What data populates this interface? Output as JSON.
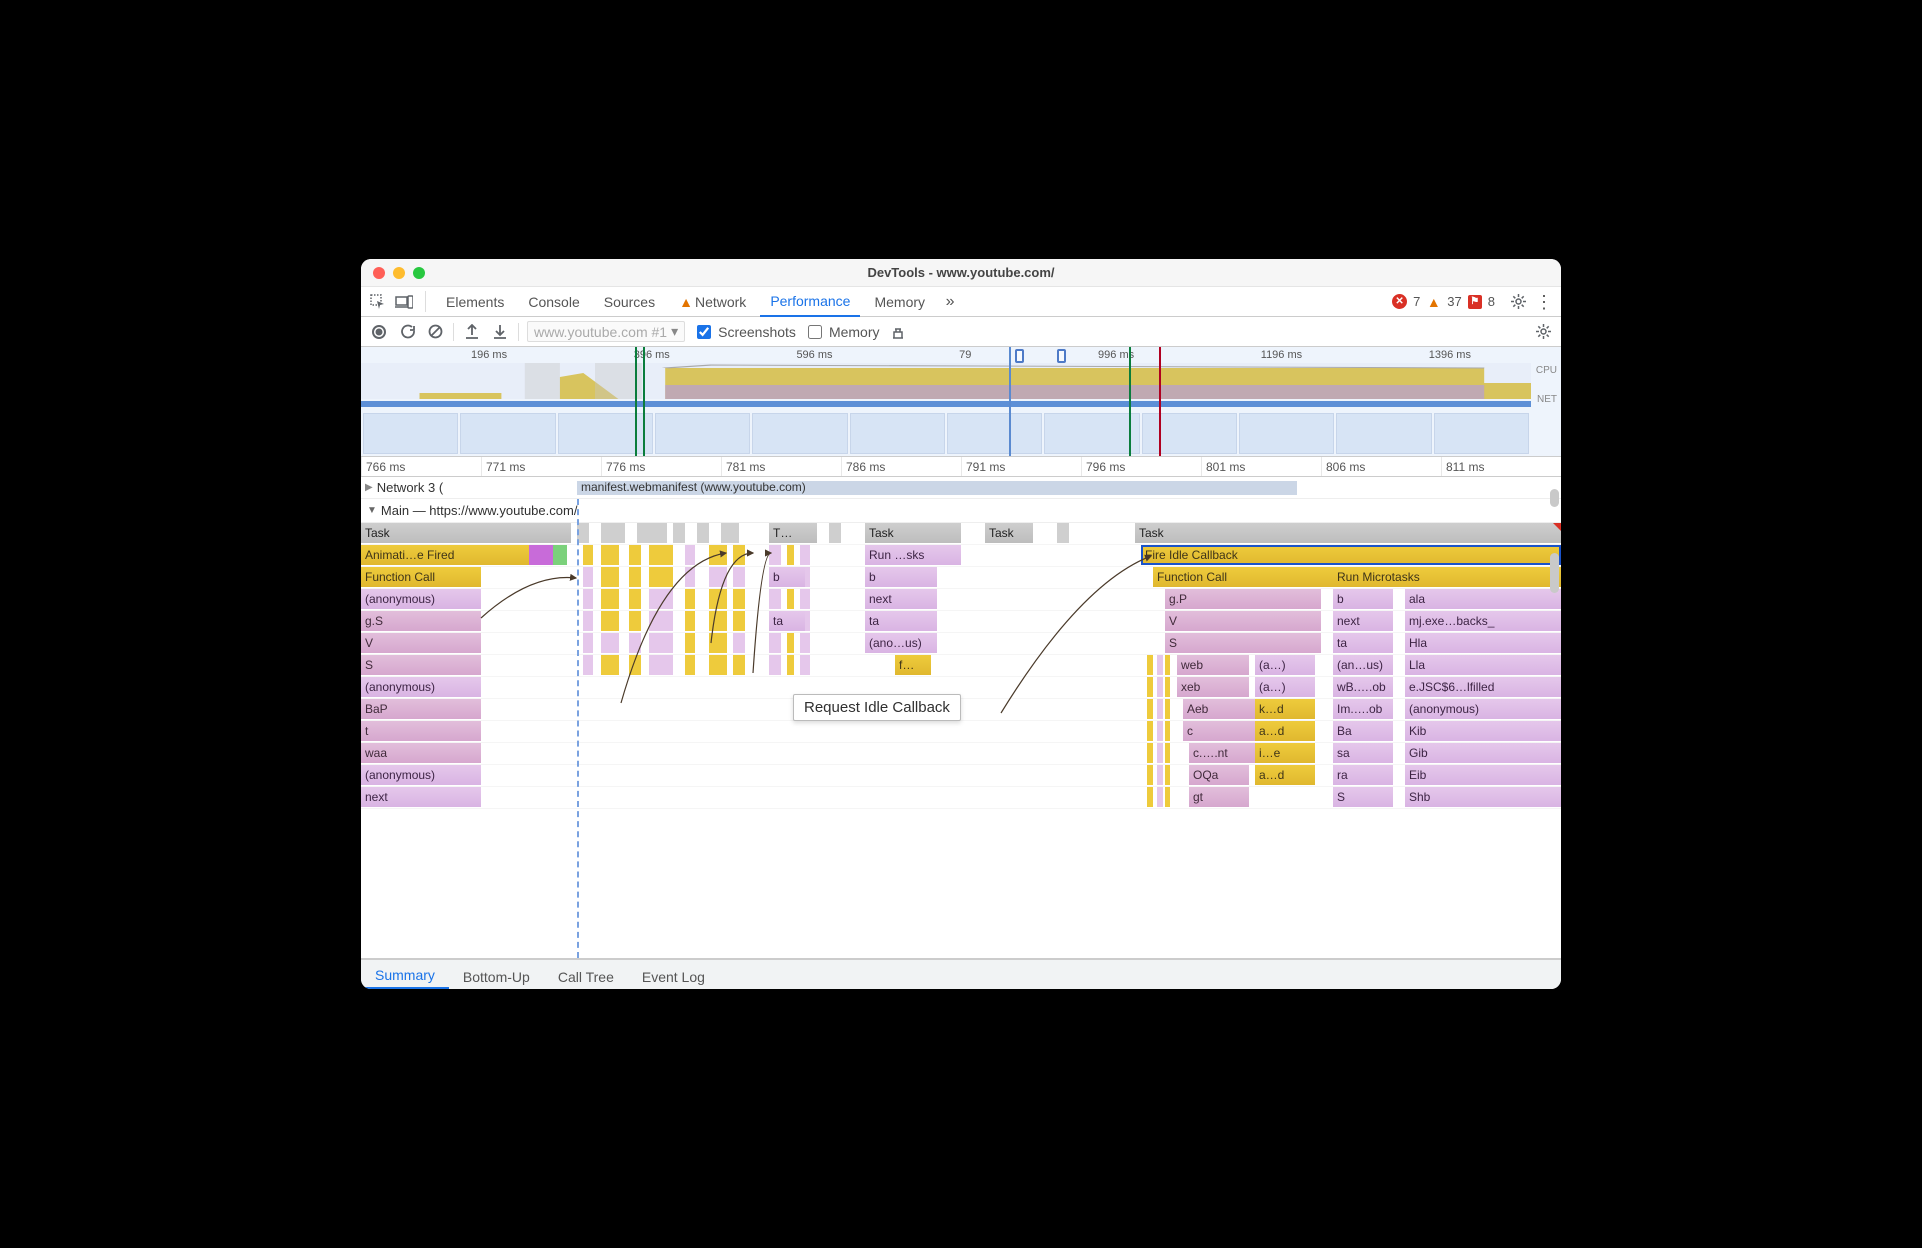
{
  "window": {
    "title": "DevTools - www.youtube.com/"
  },
  "topTabs": {
    "items": [
      "Elements",
      "Console",
      "Sources",
      "Network",
      "Performance",
      "Memory"
    ],
    "activeIndex": 4,
    "networkHasWarning": true
  },
  "counts": {
    "errors": 7,
    "warnings": 37,
    "issues": 8
  },
  "perfToolbar": {
    "target": "www.youtube.com #1",
    "screenshots": {
      "label": "Screenshots",
      "checked": true
    },
    "memory": {
      "label": "Memory",
      "checked": false
    }
  },
  "overview": {
    "ticks": [
      "196 ms",
      "396 ms",
      "596 ms",
      "79",
      "996 ms",
      "1196 ms",
      "1396 ms"
    ],
    "labels": [
      "CPU",
      "NET"
    ]
  },
  "ruler": [
    "766 ms",
    "771 ms",
    "776 ms",
    "781 ms",
    "786 ms",
    "791 ms",
    "796 ms",
    "801 ms",
    "806 ms",
    "811 ms"
  ],
  "networkLane": {
    "label": "Network  3  (",
    "request": "manifest.webmanifest (www.youtube.com)"
  },
  "mainThread": {
    "header": "Main — https://www.youtube.com/",
    "tasks": [
      "Task",
      "T…",
      "Task",
      "Task",
      "Task"
    ],
    "rows": [
      {
        "items": [
          {
            "l": 0,
            "w": 14,
            "c": "ygrad",
            "t": "Animati…e Fired"
          },
          {
            "l": 14,
            "w": 2,
            "c": "mag",
            "t": ""
          },
          {
            "l": 16,
            "w": 1.2,
            "c": "green",
            "t": ""
          },
          {
            "l": 42,
            "w": 8,
            "c": "pgrad",
            "t": "Run …sks"
          },
          {
            "l": 65,
            "w": 35,
            "c": "ygrad sel",
            "t": "Fire Idle Callback"
          }
        ]
      },
      {
        "items": [
          {
            "l": 0,
            "w": 10,
            "c": "ygrad",
            "t": "Function Call"
          },
          {
            "l": 34,
            "w": 3,
            "c": "pgrad",
            "t": "b"
          },
          {
            "l": 42,
            "w": 6,
            "c": "pgrad",
            "t": "b"
          },
          {
            "l": 66,
            "w": 15,
            "c": "ygrad",
            "t": "Function Call"
          },
          {
            "l": 81,
            "w": 19,
            "c": "ygrad",
            "t": "Run Microtasks"
          }
        ]
      },
      {
        "items": [
          {
            "l": 0,
            "w": 10,
            "c": "pgrad",
            "t": "(anonymous)"
          },
          {
            "l": 42,
            "w": 6,
            "c": "pgrad",
            "t": "next"
          },
          {
            "l": 67,
            "w": 13,
            "c": "pkgrad",
            "t": "g.P"
          },
          {
            "l": 81,
            "w": 5,
            "c": "pgrad",
            "t": "b"
          },
          {
            "l": 87,
            "w": 13,
            "c": "pgrad",
            "t": "ala"
          }
        ]
      },
      {
        "items": [
          {
            "l": 0,
            "w": 10,
            "c": "pkgrad",
            "t": "g.S"
          },
          {
            "l": 34,
            "w": 3,
            "c": "pgrad",
            "t": "ta"
          },
          {
            "l": 42,
            "w": 6,
            "c": "pgrad",
            "t": "ta"
          },
          {
            "l": 67,
            "w": 13,
            "c": "pkgrad",
            "t": "V"
          },
          {
            "l": 81,
            "w": 5,
            "c": "pgrad",
            "t": "next"
          },
          {
            "l": 87,
            "w": 13,
            "c": "pgrad",
            "t": "mj.exe…backs_"
          }
        ]
      },
      {
        "items": [
          {
            "l": 0,
            "w": 10,
            "c": "pkgrad",
            "t": "V"
          },
          {
            "l": 42,
            "w": 6,
            "c": "pgrad",
            "t": "(ano…us)"
          },
          {
            "l": 67,
            "w": 13,
            "c": "pkgrad",
            "t": "S"
          },
          {
            "l": 81,
            "w": 5,
            "c": "pgrad",
            "t": "ta"
          },
          {
            "l": 87,
            "w": 13,
            "c": "pgrad",
            "t": "Hla"
          }
        ]
      },
      {
        "items": [
          {
            "l": 0,
            "w": 10,
            "c": "pkgrad",
            "t": "S"
          },
          {
            "l": 44.5,
            "w": 3,
            "c": "ygrad",
            "t": "f…"
          },
          {
            "l": 68,
            "w": 6,
            "c": "pkgrad",
            "t": "web"
          },
          {
            "l": 74.5,
            "w": 5,
            "c": "pgrad",
            "t": "(a…)"
          },
          {
            "l": 81,
            "w": 5,
            "c": "pgrad",
            "t": "(an…us)"
          },
          {
            "l": 87,
            "w": 13,
            "c": "pgrad",
            "t": "Lla"
          }
        ]
      },
      {
        "items": [
          {
            "l": 0,
            "w": 10,
            "c": "pgrad",
            "t": "(anonymous)"
          },
          {
            "l": 68,
            "w": 6,
            "c": "pkgrad",
            "t": "xeb"
          },
          {
            "l": 74.5,
            "w": 5,
            "c": "pgrad",
            "t": "(a…)"
          },
          {
            "l": 81,
            "w": 5,
            "c": "pgrad",
            "t": "wB.….ob"
          },
          {
            "l": 87,
            "w": 13,
            "c": "pgrad",
            "t": "e.JSC$6…lfilled"
          }
        ]
      },
      {
        "items": [
          {
            "l": 0,
            "w": 10,
            "c": "pkgrad",
            "t": "BaP"
          },
          {
            "l": 68.5,
            "w": 6,
            "c": "pkgrad",
            "t": "Aeb"
          },
          {
            "l": 74.5,
            "w": 5,
            "c": "ygrad",
            "t": "k…d"
          },
          {
            "l": 81,
            "w": 5,
            "c": "pgrad",
            "t": "Im.….ob"
          },
          {
            "l": 87,
            "w": 13,
            "c": "pgrad",
            "t": "(anonymous)"
          }
        ]
      },
      {
        "items": [
          {
            "l": 0,
            "w": 10,
            "c": "pkgrad",
            "t": "t"
          },
          {
            "l": 68.5,
            "w": 6,
            "c": "pkgrad",
            "t": "c"
          },
          {
            "l": 74.5,
            "w": 5,
            "c": "ygrad",
            "t": "a…d"
          },
          {
            "l": 81,
            "w": 5,
            "c": "pgrad",
            "t": "Ba"
          },
          {
            "l": 87,
            "w": 13,
            "c": "pgrad",
            "t": "Kib"
          }
        ]
      },
      {
        "items": [
          {
            "l": 0,
            "w": 10,
            "c": "pkgrad",
            "t": "waa"
          },
          {
            "l": 69,
            "w": 6,
            "c": "pkgrad",
            "t": "c.….nt"
          },
          {
            "l": 74.5,
            "w": 5,
            "c": "ygrad",
            "t": "i…e"
          },
          {
            "l": 81,
            "w": 5,
            "c": "pgrad",
            "t": "sa"
          },
          {
            "l": 87,
            "w": 13,
            "c": "pgrad",
            "t": "Gib"
          }
        ]
      },
      {
        "items": [
          {
            "l": 0,
            "w": 10,
            "c": "pgrad",
            "t": "(anonymous)"
          },
          {
            "l": 69,
            "w": 5,
            "c": "pkgrad",
            "t": "OQa"
          },
          {
            "l": 74.5,
            "w": 5,
            "c": "ygrad",
            "t": "a…d"
          },
          {
            "l": 81,
            "w": 5,
            "c": "pgrad",
            "t": "ra"
          },
          {
            "l": 87,
            "w": 13,
            "c": "pgrad",
            "t": "Eib"
          }
        ]
      },
      {
        "items": [
          {
            "l": 0,
            "w": 10,
            "c": "pgrad",
            "t": "next"
          },
          {
            "l": 69,
            "w": 5,
            "c": "pkgrad",
            "t": "gt"
          },
          {
            "l": 81,
            "w": 5,
            "c": "pgrad",
            "t": "S"
          },
          {
            "l": 87,
            "w": 13,
            "c": "pgrad",
            "t": "Shb"
          }
        ]
      }
    ]
  },
  "tooltip": "Request Idle Callback",
  "bottomTabs": {
    "items": [
      "Summary",
      "Bottom-Up",
      "Call Tree",
      "Event Log"
    ],
    "activeIndex": 0
  }
}
